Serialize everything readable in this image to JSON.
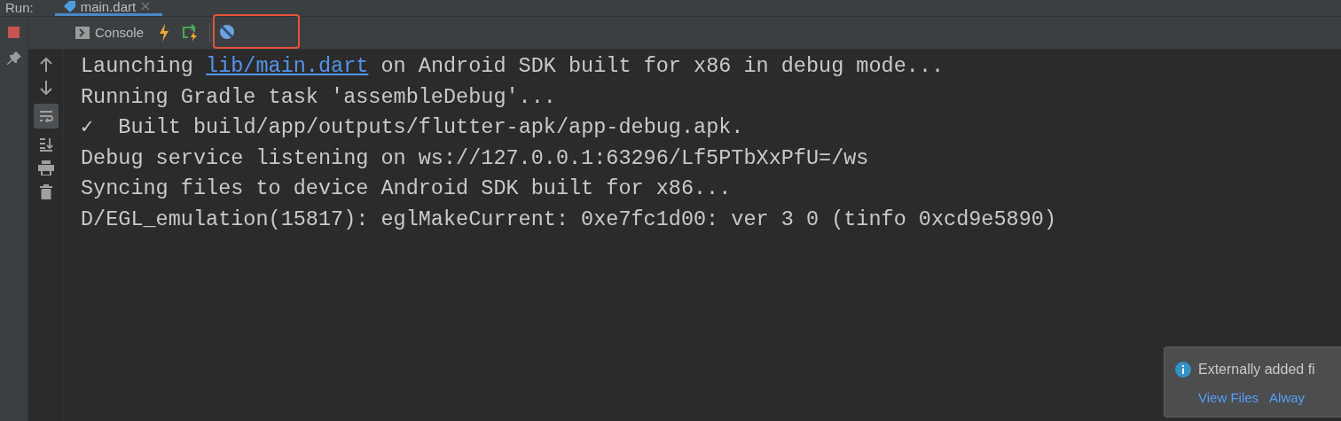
{
  "run_label": "Run:",
  "tabs": [
    {
      "label": "main.dart",
      "selected": true
    }
  ],
  "toolbar": {
    "console_label": "Console"
  },
  "console_lines": [
    [
      {
        "text": "Launching ",
        "kind": "text"
      },
      {
        "text": "lib/main.dart",
        "kind": "link"
      },
      {
        "text": " on Android SDK built for x86 in debug mode...",
        "kind": "text"
      }
    ],
    [
      {
        "text": "Running Gradle task 'assembleDebug'...",
        "kind": "text"
      }
    ],
    [
      {
        "text": "✓  Built build/app/outputs/flutter-apk/app-debug.apk.",
        "kind": "text"
      }
    ],
    [
      {
        "text": "Debug service listening on ws://127.0.0.1:63296/Lf5PTbXxPfU=/ws",
        "kind": "text"
      }
    ],
    [
      {
        "text": "Syncing files to device Android SDK built for x86...",
        "kind": "text"
      }
    ],
    [
      {
        "text": "D/EGL_emulation(15817): eglMakeCurrent: 0xe7fc1d00: ver 3 0 (tinfo 0xcd9e5890)",
        "kind": "text"
      }
    ]
  ],
  "notification": {
    "message": "Externally added fi",
    "links": [
      "View Files",
      "Alway"
    ]
  }
}
